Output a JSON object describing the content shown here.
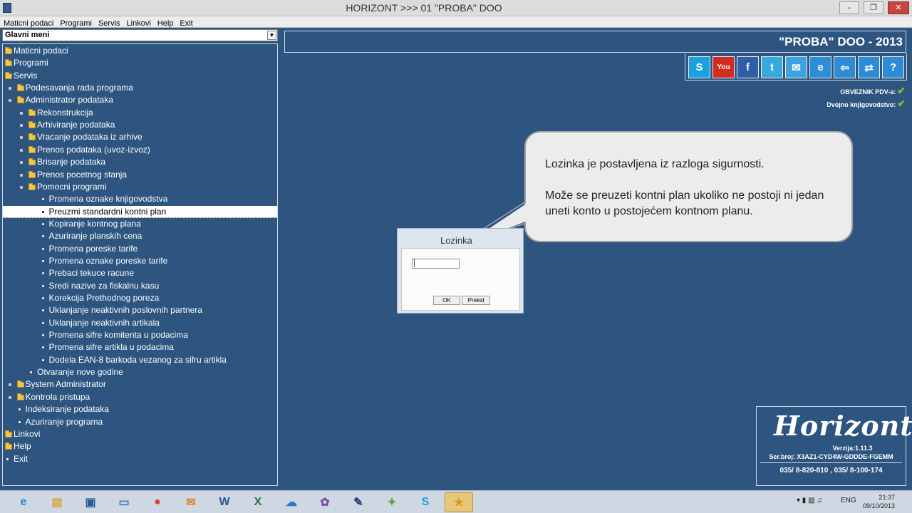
{
  "window": {
    "title": "HORIZONT   >>>   01 \"PROBA\" DOO",
    "min": "–",
    "max": "❐",
    "close": "✕"
  },
  "menubar": [
    "Maticni podaci",
    "Programi",
    "Servis",
    "Linkovi",
    "Help",
    "Exit"
  ],
  "menu_select": {
    "value": "Glavni meni"
  },
  "tree": [
    {
      "label": "Maticni podaci",
      "level": 0,
      "kind": "folder"
    },
    {
      "label": "Programi",
      "level": 0,
      "kind": "folder"
    },
    {
      "label": "Servis",
      "level": 0,
      "kind": "folder"
    },
    {
      "label": "Podesavanja rada programa",
      "level": 1,
      "kind": "folder"
    },
    {
      "label": "Administrator podataka",
      "level": 1,
      "kind": "folder"
    },
    {
      "label": "Rekonstrukcija",
      "level": 2,
      "kind": "folder"
    },
    {
      "label": "Arhiviranje podataka",
      "level": 2,
      "kind": "folder"
    },
    {
      "label": "Vracanje podataka iz arhive",
      "level": 2,
      "kind": "folder"
    },
    {
      "label": "Prenos podataka (uvoz-izvoz)",
      "level": 2,
      "kind": "folder"
    },
    {
      "label": "Brisanje podataka",
      "level": 2,
      "kind": "folder"
    },
    {
      "label": "Prenos pocetnog stanja",
      "level": 2,
      "kind": "folder"
    },
    {
      "label": "Pomocni programi",
      "level": 2,
      "kind": "folder"
    },
    {
      "label": "Promena oznake knjigovodstva",
      "level": 3,
      "kind": "item"
    },
    {
      "label": "Preuzmi standardni kontni plan",
      "level": 3,
      "kind": "item",
      "selected": true
    },
    {
      "label": "Kopiranje kontnog plana",
      "level": 3,
      "kind": "item"
    },
    {
      "label": "Azuriranje planskih cena",
      "level": 3,
      "kind": "item"
    },
    {
      "label": "Promena poreske tarife",
      "level": 3,
      "kind": "item"
    },
    {
      "label": "Promena oznake poreske tarife",
      "level": 3,
      "kind": "item"
    },
    {
      "label": "Prebaci tekuce racune",
      "level": 3,
      "kind": "item"
    },
    {
      "label": "Sredi nazive za fiskalnu kasu",
      "level": 3,
      "kind": "item"
    },
    {
      "label": "Korekcija Prethodnog poreza",
      "level": 3,
      "kind": "item"
    },
    {
      "label": "Uklanjanje neaktivnih poslovnih partnera",
      "level": 3,
      "kind": "item"
    },
    {
      "label": "Uklanjanje neaktivnih artikala",
      "level": 3,
      "kind": "item"
    },
    {
      "label": "Promena sifre komitenta u podacima",
      "level": 3,
      "kind": "item"
    },
    {
      "label": "Promena sifre artikla u podacima",
      "level": 3,
      "kind": "item"
    },
    {
      "label": "Dodela EAN-8 barkoda vezanog za sifru artikla",
      "level": 3,
      "kind": "item"
    },
    {
      "label": "Otvaranje nove godine",
      "level": 2,
      "kind": "item"
    },
    {
      "label": "System Administrator",
      "level": 1,
      "kind": "folder"
    },
    {
      "label": "Kontrola pristupa",
      "level": 1,
      "kind": "folder"
    },
    {
      "label": "Indeksiranje podataka",
      "level": 1,
      "kind": "item"
    },
    {
      "label": "Azuriranje programa",
      "level": 1,
      "kind": "item"
    },
    {
      "label": "Linkovi",
      "level": 0,
      "kind": "folder"
    },
    {
      "label": "Help",
      "level": 0,
      "kind": "folder"
    },
    {
      "label": "Exit",
      "level": 0,
      "kind": "item"
    }
  ],
  "company": {
    "name": "\"PROBA\" DOO - 2013"
  },
  "social_icons": [
    {
      "name": "skype-icon",
      "glyph": "S",
      "color": "#1aa1e0"
    },
    {
      "name": "youtube-icon",
      "glyph": "You",
      "color": "#d22b20"
    },
    {
      "name": "facebook-icon",
      "glyph": "f",
      "color": "#2f5ea8"
    },
    {
      "name": "twitter-icon",
      "glyph": "t",
      "color": "#38a9dd"
    },
    {
      "name": "mail-icon",
      "glyph": "✉",
      "color": "#3ba3e0"
    },
    {
      "name": "internet-explorer-icon",
      "glyph": "e",
      "color": "#2c8fd6"
    },
    {
      "name": "back-arrow-icon",
      "glyph": "⇦",
      "color": "#2e8bd6"
    },
    {
      "name": "swap-arrows-icon",
      "glyph": "⇄",
      "color": "#2e8bd6"
    },
    {
      "name": "help-icon",
      "glyph": "?",
      "color": "#2e8bd6"
    }
  ],
  "flags": [
    {
      "label": "OBVEZNIK PDV-a:",
      "check": "✔"
    },
    {
      "label": "Dvojno knjigovodstvo:",
      "check": "✔"
    }
  ],
  "callout": {
    "line1": "Lozinka je postavljena  iz razloga sigurnosti.",
    "line2": "Može se preuzeti kontni plan ukoliko ne postoji ni jedan uneti konto u postojećem kontnom planu."
  },
  "dialog": {
    "title": "Lozinka",
    "ok": "OK",
    "cancel": "Prekid"
  },
  "about": {
    "logo": "Horizont",
    "version": "Verzija:1.11.3",
    "serial": "Ser.broj:  X3AZ1-CYD4W-GDDDE-FGEMM",
    "phones": "035/ 8-820-810 , 035/ 8-100-174"
  },
  "taskbar": {
    "apps": [
      {
        "name": "internet-explorer-icon",
        "glyph": "e",
        "color": "#1d86d1"
      },
      {
        "name": "file-explorer-icon",
        "glyph": "▤",
        "color": "#d6a83c"
      },
      {
        "name": "remote-desktop-icon",
        "glyph": "▣",
        "color": "#2a5d9a"
      },
      {
        "name": "remote-app-icon",
        "glyph": "▭",
        "color": "#3b74b4"
      },
      {
        "name": "chrome-icon",
        "glyph": "●",
        "color": "#d9463a"
      },
      {
        "name": "mail-app-icon",
        "glyph": "✉",
        "color": "#e27c2a"
      },
      {
        "name": "word-icon",
        "glyph": "W",
        "color": "#2b579a"
      },
      {
        "name": "excel-icon",
        "glyph": "X",
        "color": "#217346"
      },
      {
        "name": "onedrive-icon",
        "glyph": "☁",
        "color": "#2a78c8"
      },
      {
        "name": "tool-icon",
        "glyph": "✿",
        "color": "#7b4ea0"
      },
      {
        "name": "pen-icon",
        "glyph": "✎",
        "color": "#1b3c75"
      },
      {
        "name": "picasa-icon",
        "glyph": "✦",
        "color": "#5aa63a"
      },
      {
        "name": "skype-taskbar-icon",
        "glyph": "S",
        "color": "#1aa1e0"
      },
      {
        "name": "horizont-app-icon",
        "glyph": "★",
        "color": "#d99a1d",
        "active": true
      }
    ],
    "lang": "ENG",
    "time": "21:37",
    "date": "09/10/2013"
  }
}
